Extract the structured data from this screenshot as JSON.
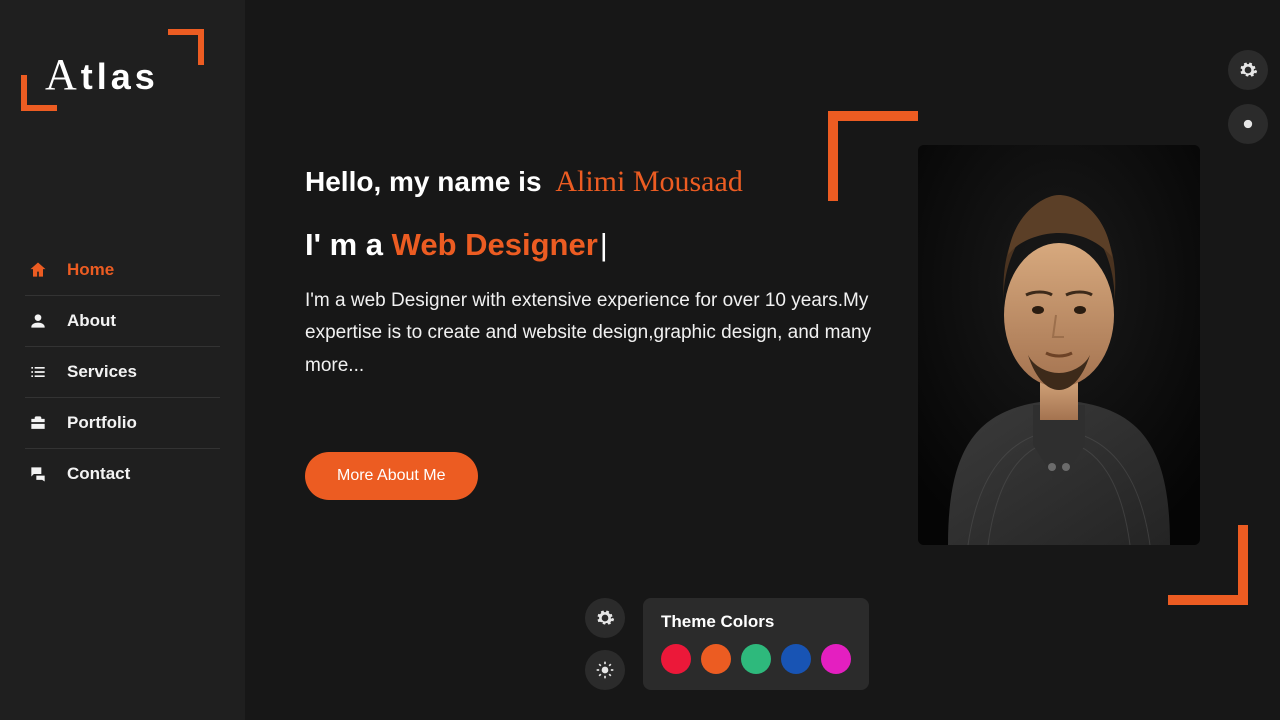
{
  "brand": {
    "name": "Atlas",
    "first_letter": "A",
    "rest": "tlas"
  },
  "nav": [
    {
      "id": "home",
      "label": "Home",
      "icon": "home-icon",
      "active": true
    },
    {
      "id": "about",
      "label": "About",
      "icon": "user-icon",
      "active": false
    },
    {
      "id": "services",
      "label": "Services",
      "icon": "list-icon",
      "active": false
    },
    {
      "id": "portfolio",
      "label": "Portfolio",
      "icon": "briefcase-icon",
      "active": false
    },
    {
      "id": "contact",
      "label": "Contact",
      "icon": "chat-icon",
      "active": false
    }
  ],
  "hero": {
    "greeting_prefix": "Hello, my name is",
    "name": "Alimi Mousaad",
    "role_prefix": "I' m a ",
    "role": "Web Designer",
    "cursor": "|",
    "description": "I'm a web Designer with extensive experience for over 10 years.My expertise is to create and website design,graphic design, and many more...",
    "cta_label": "More About Me"
  },
  "theme_panel": {
    "title": "Theme Colors",
    "colors": [
      "#ec1839",
      "#ec5c22",
      "#2eb97c",
      "#1854b4",
      "#e41fc0"
    ]
  },
  "accent": "#ec5c22"
}
